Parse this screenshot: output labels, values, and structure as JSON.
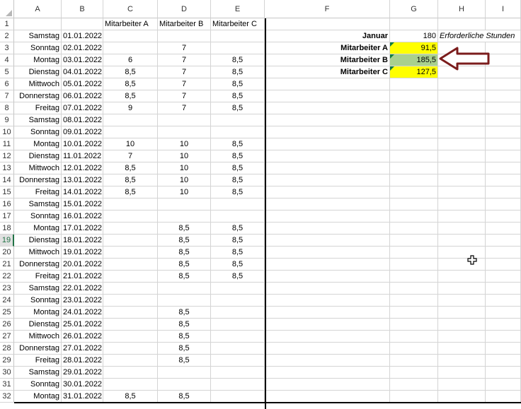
{
  "columns": [
    "A",
    "B",
    "C",
    "D",
    "E",
    "F",
    "G",
    "H",
    "I"
  ],
  "row_numbers": [
    "1",
    "2",
    "3",
    "4",
    "5",
    "6",
    "7",
    "8",
    "9",
    "10",
    "11",
    "12",
    "13",
    "14",
    "15",
    "16",
    "17",
    "18",
    "19",
    "20",
    "21",
    "22",
    "23",
    "24",
    "25",
    "26",
    "27",
    "28",
    "29",
    "30",
    "31",
    "32"
  ],
  "headers": {
    "c1": "Mitarbeiter A",
    "d1": "Mitarbeiter B",
    "e1": "Mitarbeiter C"
  },
  "rows": [
    {
      "a": "",
      "b": "",
      "c": "",
      "d": "",
      "e": ""
    },
    {
      "a": "Samstag",
      "b": "01.01.2022",
      "c": "",
      "d": "",
      "e": ""
    },
    {
      "a": "Sonntag",
      "b": "02.01.2022",
      "c": "",
      "d": "7",
      "e": ""
    },
    {
      "a": "Montag",
      "b": "03.01.2022",
      "c": "6",
      "d": "7",
      "e": "8,5"
    },
    {
      "a": "Dienstag",
      "b": "04.01.2022",
      "c": "8,5",
      "d": "7",
      "e": "8,5"
    },
    {
      "a": "Mittwoch",
      "b": "05.01.2022",
      "c": "8,5",
      "d": "7",
      "e": "8,5"
    },
    {
      "a": "Donnerstag",
      "b": "06.01.2022",
      "c": "8,5",
      "d": "7",
      "e": "8,5"
    },
    {
      "a": "Freitag",
      "b": "07.01.2022",
      "c": "9",
      "d": "7",
      "e": "8,5"
    },
    {
      "a": "Samstag",
      "b": "08.01.2022",
      "c": "",
      "d": "",
      "e": ""
    },
    {
      "a": "Sonntag",
      "b": "09.01.2022",
      "c": "",
      "d": "",
      "e": ""
    },
    {
      "a": "Montag",
      "b": "10.01.2022",
      "c": "10",
      "d": "10",
      "e": "8,5"
    },
    {
      "a": "Dienstag",
      "b": "11.01.2022",
      "c": "7",
      "d": "10",
      "e": "8,5"
    },
    {
      "a": "Mittwoch",
      "b": "12.01.2022",
      "c": "8,5",
      "d": "10",
      "e": "8,5"
    },
    {
      "a": "Donnerstag",
      "b": "13.01.2022",
      "c": "8,5",
      "d": "10",
      "e": "8,5"
    },
    {
      "a": "Freitag",
      "b": "14.01.2022",
      "c": "8,5",
      "d": "10",
      "e": "8,5"
    },
    {
      "a": "Samstag",
      "b": "15.01.2022",
      "c": "",
      "d": "",
      "e": ""
    },
    {
      "a": "Sonntag",
      "b": "16.01.2022",
      "c": "",
      "d": "",
      "e": ""
    },
    {
      "a": "Montag",
      "b": "17.01.2022",
      "c": "",
      "d": "8,5",
      "e": "8,5"
    },
    {
      "a": "Dienstag",
      "b": "18.01.2022",
      "c": "",
      "d": "8,5",
      "e": "8,5"
    },
    {
      "a": "Mittwoch",
      "b": "19.01.2022",
      "c": "",
      "d": "8,5",
      "e": "8,5"
    },
    {
      "a": "Donnerstag",
      "b": "20.01.2022",
      "c": "",
      "d": "8,5",
      "e": "8,5"
    },
    {
      "a": "Freitag",
      "b": "21.01.2022",
      "c": "",
      "d": "8,5",
      "e": "8,5"
    },
    {
      "a": "Samstag",
      "b": "22.01.2022",
      "c": "",
      "d": "",
      "e": ""
    },
    {
      "a": "Sonntag",
      "b": "23.01.2022",
      "c": "",
      "d": "",
      "e": ""
    },
    {
      "a": "Montag",
      "b": "24.01.2022",
      "c": "",
      "d": "8,5",
      "e": ""
    },
    {
      "a": "Dienstag",
      "b": "25.01.2022",
      "c": "",
      "d": "8,5",
      "e": ""
    },
    {
      "a": "Mittwoch",
      "b": "26.01.2022",
      "c": "",
      "d": "8,5",
      "e": ""
    },
    {
      "a": "Donnerstag",
      "b": "27.01.2022",
      "c": "",
      "d": "8,5",
      "e": ""
    },
    {
      "a": "Freitag",
      "b": "28.01.2022",
      "c": "",
      "d": "8,5",
      "e": ""
    },
    {
      "a": "Samstag",
      "b": "29.01.2022",
      "c": "",
      "d": "",
      "e": ""
    },
    {
      "a": "Sonntag",
      "b": "30.01.2022",
      "c": "",
      "d": "",
      "e": ""
    },
    {
      "a": "Montag",
      "b": "31.01.2022",
      "c": "8,5",
      "d": "8,5",
      "e": ""
    }
  ],
  "summary": {
    "month_label": "Januar",
    "month_value": "180",
    "required_label": "Erforderliche Stunden",
    "ma_label": "Mitarbeiter A",
    "ma_value": "91,5",
    "mb_label": "Mitarbeiter B",
    "mb_value": "185,5",
    "mc_label": "Mitarbeiter C",
    "mc_value": "127,5"
  },
  "colors": {
    "yellow": "#ffff00",
    "green": "#a9d08e",
    "arrow": "#7b1c1c",
    "accent": "#217346"
  },
  "icons": {
    "arrow": "left-arrow-icon",
    "cursor": "plus-cursor-icon"
  },
  "active_row": "19"
}
